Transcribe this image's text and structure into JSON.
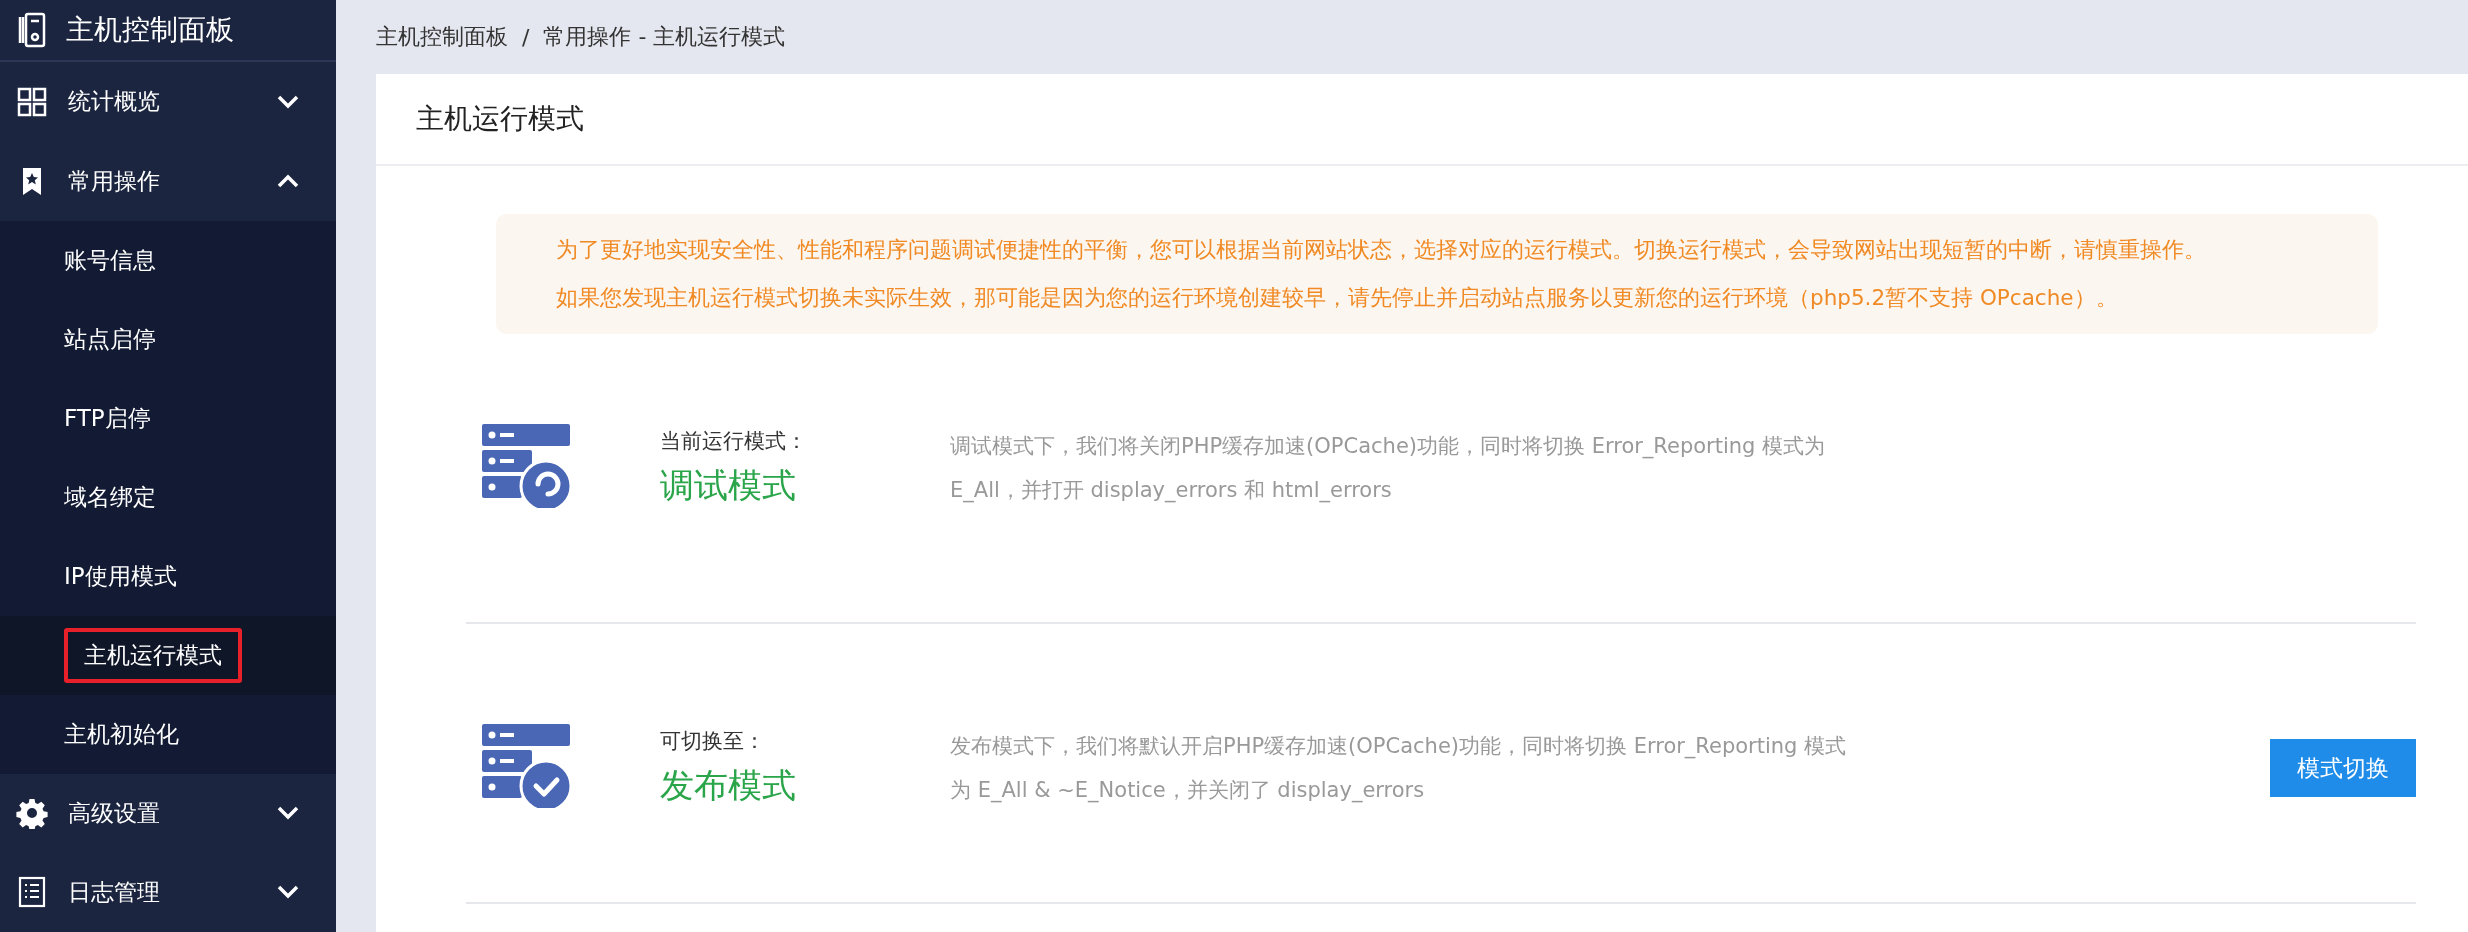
{
  "sidebar": {
    "title": "主机控制面板",
    "sections": [
      {
        "label": "统计概览",
        "expanded": false
      },
      {
        "label": "常用操作",
        "expanded": true,
        "items": [
          {
            "label": "账号信息",
            "selected": false,
            "highlighted": false
          },
          {
            "label": "站点启停",
            "selected": false,
            "highlighted": false
          },
          {
            "label": "FTP启停",
            "selected": false,
            "highlighted": false
          },
          {
            "label": "域名绑定",
            "selected": false,
            "highlighted": false
          },
          {
            "label": "IP使用模式",
            "selected": false,
            "highlighted": false
          },
          {
            "label": "主机运行模式",
            "selected": true,
            "highlighted": true
          },
          {
            "label": "主机初始化",
            "selected": false,
            "highlighted": false
          }
        ]
      },
      {
        "label": "高级设置",
        "expanded": false
      },
      {
        "label": "日志管理",
        "expanded": false
      }
    ]
  },
  "breadcrumb": [
    "主机控制面板",
    "常用操作 - 主机运行模式"
  ],
  "breadcrumb_separator": "/",
  "card": {
    "title": "主机运行模式",
    "notice": [
      "为了更好地实现安全性、性能和程序问题调试便捷性的平衡，您可以根据当前网站状态，选择对应的运行模式。切换运行模式，会导致网站出现短暂的中断，请慎重操作。",
      "如果您发现主机运行模式切换未实际生效，那可能是因为您的运行环境创建较早，请先停止并启动站点服务以更新您的运行环境（php5.2暂不支持 OPcache）。"
    ],
    "modes": [
      {
        "kind": "current",
        "label": "当前运行模式：",
        "name": "调试模式",
        "description": "调试模式下，我们将关闭PHP缓存加速(OPCache)功能，同时将切换 Error_Reporting 模式为 E_All，并打开 display_errors 和 html_errors"
      },
      {
        "kind": "target",
        "label": "可切换至：",
        "name": "发布模式",
        "description": "发布模式下，我们将默认开启PHP缓存加速(OPCache)功能，同时将切换 Error_Reporting 模式为 E_All & ~E_Notice，并关闭了 display_errors",
        "button": "模式切换"
      }
    ]
  }
}
